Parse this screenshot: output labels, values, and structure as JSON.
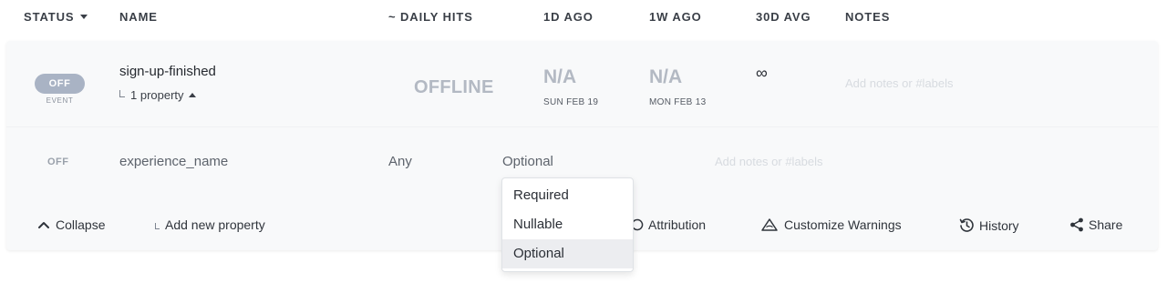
{
  "header": {
    "status": "STATUS",
    "name": "NAME",
    "daily_hits": "~ DAILY HITS",
    "one_day": "1D AGO",
    "one_week": "1W AGO",
    "thirty_day": "30D AVG",
    "notes": "NOTES"
  },
  "event": {
    "status": "OFF",
    "type": "EVENT",
    "name": "sign-up-finished",
    "property_count": "1 property",
    "daily_hits": "OFFLINE",
    "one_day_value": "N/A",
    "one_day_date": "SUN FEB 19",
    "one_week_value": "N/A",
    "one_week_date": "MON FEB 13",
    "thirty_day_avg": "∞",
    "notes_placeholder": "Add notes or #labels"
  },
  "property": {
    "status": "OFF",
    "name": "experience_name",
    "type": "Any",
    "requirement": "Optional",
    "notes_placeholder": "Add notes or #labels"
  },
  "actions": {
    "collapse": "Collapse",
    "add_property": "Add new property",
    "attribution": "Attribution",
    "customize_warnings": "Customize Warnings",
    "history": "History",
    "share": "Share"
  },
  "requirement_menu": {
    "options": [
      "Required",
      "Nullable",
      "Optional"
    ],
    "selected": "Optional"
  },
  "icons": {
    "collapse": "chevron-up-icon",
    "attribution": "speech-bubble-icon",
    "warnings": "warning-triangle-icon",
    "history": "history-clock-icon",
    "share": "share-icon"
  },
  "colors": {
    "status_pill": "#a9b3c4",
    "muted_metric": "#b3b9c3",
    "selected_option_bg": "#ecedf0"
  }
}
